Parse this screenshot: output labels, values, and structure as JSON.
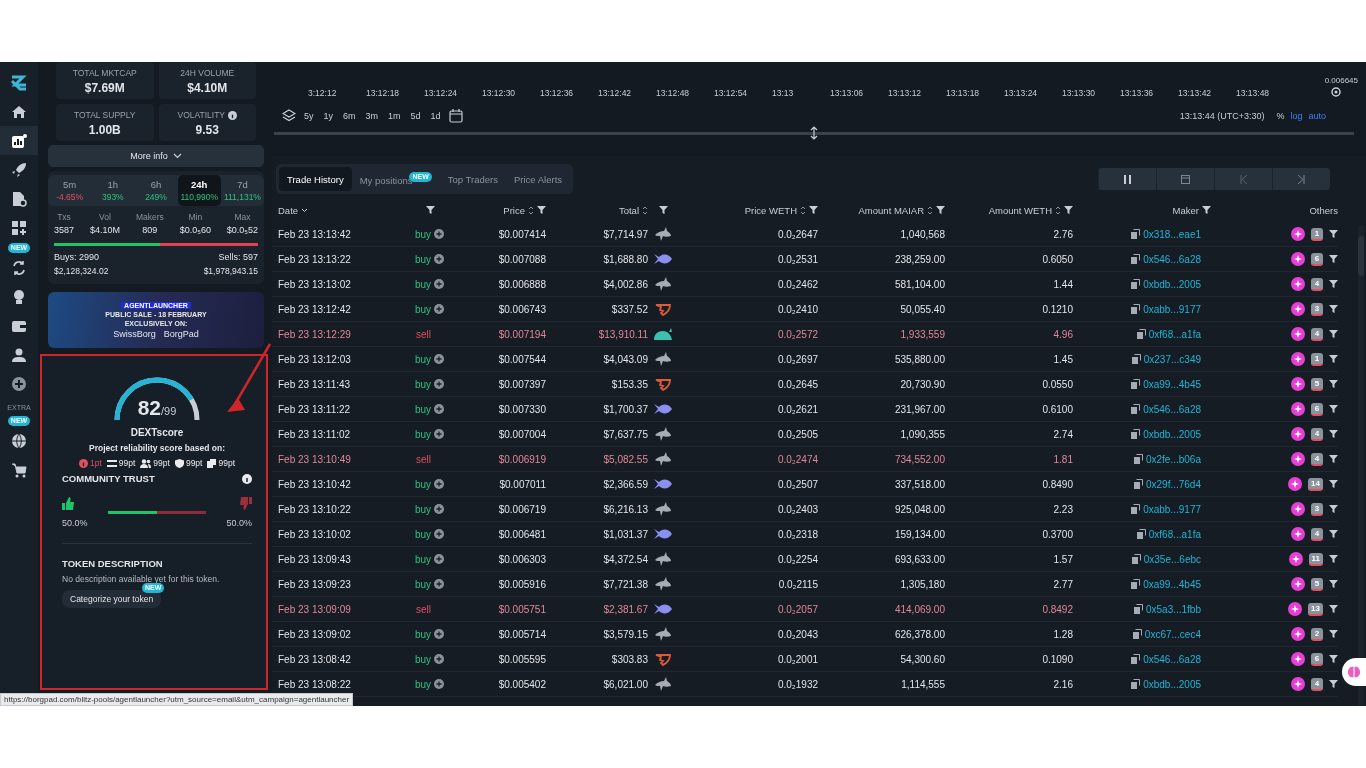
{
  "sidebar": {
    "items": [
      {
        "kind": "logo",
        "selected": false
      },
      {
        "kind": "home",
        "selected": false
      },
      {
        "kind": "chart",
        "selected": true
      },
      {
        "kind": "rocket",
        "selected": false
      },
      {
        "kind": "document",
        "selected": false
      },
      {
        "kind": "apps",
        "selected": false
      },
      {
        "kind": "swap",
        "selected": false,
        "badge": "NEW"
      },
      {
        "kind": "bulb",
        "selected": false
      },
      {
        "kind": "wallet",
        "selected": false
      },
      {
        "kind": "user",
        "selected": false
      },
      {
        "kind": "plus",
        "selected": false
      },
      {
        "kind": "label",
        "label": "EXTRA"
      },
      {
        "kind": "globe",
        "selected": false,
        "badge": "NEW"
      },
      {
        "kind": "cart",
        "selected": false
      }
    ]
  },
  "stats": [
    {
      "label": "TOTAL MKTCAP",
      "value": "$7.69M",
      "info": false
    },
    {
      "label": "24H VOLUME",
      "value": "$4.10M",
      "info": false
    },
    {
      "label": "TOTAL SUPPLY",
      "value": "1.00B",
      "info": false
    },
    {
      "label": "VOLATILITY",
      "value": "9.53",
      "info": true
    }
  ],
  "more_info": "More info",
  "timeframes": [
    {
      "label": "5m",
      "change": "-4.65%",
      "negative": true,
      "selected": false
    },
    {
      "label": "1h",
      "change": "393%",
      "negative": false,
      "selected": false
    },
    {
      "label": "6h",
      "change": "249%",
      "negative": false,
      "selected": false
    },
    {
      "label": "24h",
      "change": "110,990%",
      "negative": false,
      "selected": true
    },
    {
      "label": "7d",
      "change": "111,131%",
      "negative": false,
      "selected": false
    }
  ],
  "metrics": [
    {
      "label": "Txs",
      "value": "3587"
    },
    {
      "label": "Vol",
      "value": "$4.10M"
    },
    {
      "label": "Makers",
      "value": "809"
    },
    {
      "label": "Min",
      "value": "$0.0₅60"
    },
    {
      "label": "Max",
      "value": "$0.0₅52"
    }
  ],
  "buys_sells": {
    "level": 0.52,
    "buys": "Buys: 2990",
    "buys_amount": "$2,128,324.02",
    "sells": "Sells: 597",
    "sells_amount": "$1,978,943.15"
  },
  "banner": {
    "title": "AGENTLAUNCHER",
    "line_1": "PUBLIC SALE - 18 FEBRUARY",
    "line_2": "EXCLUSIVELY ON:",
    "partner_1": "SwissBorg",
    "partner_2": "BorgPad"
  },
  "score": {
    "value": "82",
    "max": "/99",
    "title": "DEXTscore",
    "subtitle": "Project reliability score based on:",
    "parts": [
      {
        "kind": "info",
        "value": "1pt",
        "color": "#e0505f"
      },
      {
        "kind": "swap",
        "value": "99pt",
        "color": "#e8eaee"
      },
      {
        "kind": "users",
        "value": "99pt",
        "color": "#e8eaee"
      },
      {
        "kind": "shield",
        "value": "99pt",
        "color": "#e8eaee"
      },
      {
        "kind": "copy",
        "value": "99pt",
        "color": "#e8eaee"
      }
    ],
    "trust": {
      "title": "COMMUNITY TRUST",
      "level": 0.5,
      "up": "50.0%",
      "down": "50.0%"
    },
    "description_title": "TOKEN DESCRIPTION",
    "description": "No description available yet for this token.",
    "categorize": "Categorize your token",
    "categorize_badge": "NEW"
  },
  "status_url": "https://borgpad.com/blitz-pools/agentlauncher?utm_source=email&utm_campaign=agentlauncher",
  "chart": {
    "price_label": "0.006645",
    "times": [
      "3:12:12",
      "13:12:18",
      "13:12:24",
      "13:12:30",
      "13:12:36",
      "13:12:42",
      "13:12:48",
      "13:12:54",
      "13:13",
      "13:13:06",
      "13:13:12",
      "13:13:18",
      "13:13:24",
      "13:13:30",
      "13:13:36",
      "13:13:42",
      "13:13:48"
    ],
    "ranges": [
      "5y",
      "1y",
      "6m",
      "3m",
      "1m",
      "5d",
      "1d"
    ],
    "clock": "13:13:44 (UTC+3:30)",
    "scales": [
      {
        "label": "%",
        "selected": false
      },
      {
        "label": "log",
        "selected": true
      },
      {
        "label": "auto",
        "selected": true
      }
    ]
  },
  "tabs": [
    {
      "label": "Trade History",
      "selected": true
    },
    {
      "label": "My positions",
      "selected": false,
      "badge": "NEW"
    },
    {
      "label": "Top Traders",
      "selected": false
    },
    {
      "label": "Price Alerts",
      "selected": false
    }
  ],
  "controls": [
    {
      "kind": "pause"
    },
    {
      "kind": "calendar"
    },
    {
      "kind": "prev"
    },
    {
      "kind": "next"
    }
  ],
  "columns": [
    {
      "label": "Date",
      "dropdown": true,
      "sortable": false,
      "filter": false
    },
    {
      "dropdown": false,
      "sortable": false,
      "filter": true
    },
    {
      "label": "Price",
      "dropdown": false,
      "sortable": true,
      "filter": true
    },
    {
      "label": "Total",
      "dropdown": false,
      "sortable": true,
      "filter": false
    },
    {
      "dropdown": false,
      "sortable": false,
      "filter": true
    },
    {
      "label": "Price WETH",
      "dropdown": false,
      "sortable": true,
      "filter": true
    },
    {
      "label": "Amount MAIAR",
      "dropdown": false,
      "sortable": true,
      "filter": true
    },
    {
      "label": "Amount WETH",
      "dropdown": false,
      "sortable": true,
      "filter": true
    },
    {
      "label": "Maker",
      "dropdown": false,
      "sortable": false,
      "filter": true
    },
    {
      "label": "Others",
      "dropdown": false,
      "sortable": false,
      "filter": false
    }
  ],
  "rows": [
    {
      "date": "Feb 23 13:13:42",
      "type": "buy",
      "price": "$0.007414",
      "total": "$7,714.97",
      "kind": "shark",
      "price_weth": "0.0₂2647",
      "amount_maiar": "1,040,568",
      "amount_weth": "2.76",
      "maker": "0x318...eae1",
      "count": "1"
    },
    {
      "date": "Feb 23 13:13:22",
      "type": "buy",
      "price": "$0.007088",
      "total": "$1,688.80",
      "kind": "fish",
      "price_weth": "0.0₂2531",
      "amount_maiar": "238,259.00",
      "amount_weth": "0.6050",
      "maker": "0x546...6a28",
      "count": "6"
    },
    {
      "date": "Feb 23 13:13:02",
      "type": "buy",
      "price": "$0.006888",
      "total": "$4,002.86",
      "kind": "shark",
      "price_weth": "0.0₂2462",
      "amount_maiar": "581,104.00",
      "amount_weth": "1.44",
      "maker": "0xbdb...2005",
      "count": "4"
    },
    {
      "date": "Feb 23 13:12:42",
      "type": "buy",
      "price": "$0.006743",
      "total": "$337.52",
      "kind": "shrimp",
      "price_weth": "0.0₂2410",
      "amount_maiar": "50,055.40",
      "amount_weth": "0.1210",
      "maker": "0xabb...9177",
      "count": "3"
    },
    {
      "date": "Feb 23 13:12:29",
      "type": "sell",
      "price": "$0.007194",
      "total": "$13,910.11",
      "kind": "whale",
      "price_weth": "0.0₂2572",
      "amount_maiar": "1,933,559",
      "amount_weth": "4.96",
      "maker": "0xf68...a1fa",
      "count": "4"
    },
    {
      "date": "Feb 23 13:12:03",
      "type": "buy",
      "price": "$0.007544",
      "total": "$4,043.09",
      "kind": "shark",
      "price_weth": "0.0₂2697",
      "amount_maiar": "535,880.00",
      "amount_weth": "1.45",
      "maker": "0x237...c349",
      "count": "1"
    },
    {
      "date": "Feb 23 13:11:43",
      "type": "buy",
      "price": "$0.007397",
      "total": "$153.35",
      "kind": "shrimp",
      "price_weth": "0.0₂2645",
      "amount_maiar": "20,730.90",
      "amount_weth": "0.0550",
      "maker": "0xa99...4b45",
      "count": "5"
    },
    {
      "date": "Feb 23 13:11:22",
      "type": "buy",
      "price": "$0.007330",
      "total": "$1,700.37",
      "kind": "fish",
      "price_weth": "0.0₂2621",
      "amount_maiar": "231,967.00",
      "amount_weth": "0.6100",
      "maker": "0x546...6a28",
      "count": "6"
    },
    {
      "date": "Feb 23 13:11:02",
      "type": "buy",
      "price": "$0.007004",
      "total": "$7,637.75",
      "kind": "shark",
      "price_weth": "0.0₂2505",
      "amount_maiar": "1,090,355",
      "amount_weth": "2.74",
      "maker": "0xbdb...2005",
      "count": "4"
    },
    {
      "date": "Feb 23 13:10:49",
      "type": "sell",
      "price": "$0.006919",
      "total": "$5,082.55",
      "kind": "shark",
      "price_weth": "0.0₂2474",
      "amount_maiar": "734,552.00",
      "amount_weth": "1.81",
      "maker": "0x2fe...b06a",
      "count": "4"
    },
    {
      "date": "Feb 23 13:10:42",
      "type": "buy",
      "price": "$0.007011",
      "total": "$2,366.59",
      "kind": "fish",
      "price_weth": "0.0₂2507",
      "amount_maiar": "337,518.00",
      "amount_weth": "0.8490",
      "maker": "0x29f...76d4",
      "count": "14"
    },
    {
      "date": "Feb 23 13:10:22",
      "type": "buy",
      "price": "$0.006719",
      "total": "$6,216.13",
      "kind": "shark",
      "price_weth": "0.0₂2403",
      "amount_maiar": "925,048.00",
      "amount_weth": "2.23",
      "maker": "0xabb...9177",
      "count": "3"
    },
    {
      "date": "Feb 23 13:10:02",
      "type": "buy",
      "price": "$0.006481",
      "total": "$1,031.37",
      "kind": "fish",
      "price_weth": "0.0₂2318",
      "amount_maiar": "159,134.00",
      "amount_weth": "0.3700",
      "maker": "0xf68...a1fa",
      "count": "4"
    },
    {
      "date": "Feb 23 13:09:43",
      "type": "buy",
      "price": "$0.006303",
      "total": "$4,372.54",
      "kind": "shark",
      "price_weth": "0.0₂2254",
      "amount_maiar": "693,633.00",
      "amount_weth": "1.57",
      "maker": "0x35e...6ebc",
      "count": "11"
    },
    {
      "date": "Feb 23 13:09:23",
      "type": "buy",
      "price": "$0.005916",
      "total": "$7,721.38",
      "kind": "shark",
      "price_weth": "0.0₂2115",
      "amount_maiar": "1,305,180",
      "amount_weth": "2.77",
      "maker": "0xa99...4b45",
      "count": "5"
    },
    {
      "date": "Feb 23 13:09:09",
      "type": "sell",
      "price": "$0.005751",
      "total": "$2,381.67",
      "kind": "fish",
      "price_weth": "0.0₂2057",
      "amount_maiar": "414,069.00",
      "amount_weth": "0.8492",
      "maker": "0x5a3...1fbb",
      "count": "13"
    },
    {
      "date": "Feb 23 13:09:02",
      "type": "buy",
      "price": "$0.005714",
      "total": "$3,579.15",
      "kind": "shark",
      "price_weth": "0.0₂2043",
      "amount_maiar": "626,378.00",
      "amount_weth": "1.28",
      "maker": "0xc67...cec4",
      "count": "2"
    },
    {
      "date": "Feb 23 13:08:42",
      "type": "buy",
      "price": "$0.005595",
      "total": "$303.83",
      "kind": "shrimp",
      "price_weth": "0.0₂2001",
      "amount_maiar": "54,300.60",
      "amount_weth": "0.1090",
      "maker": "0x546...6a28",
      "count": "6"
    },
    {
      "date": "Feb 23 13:08:22",
      "type": "buy",
      "price": "$0.005402",
      "total": "$6,021.00",
      "kind": "shark",
      "price_weth": "0.0₂1932",
      "amount_maiar": "1,114,555",
      "amount_weth": "2.16",
      "maker": "0xbdb...2005",
      "count": "4"
    }
  ]
}
